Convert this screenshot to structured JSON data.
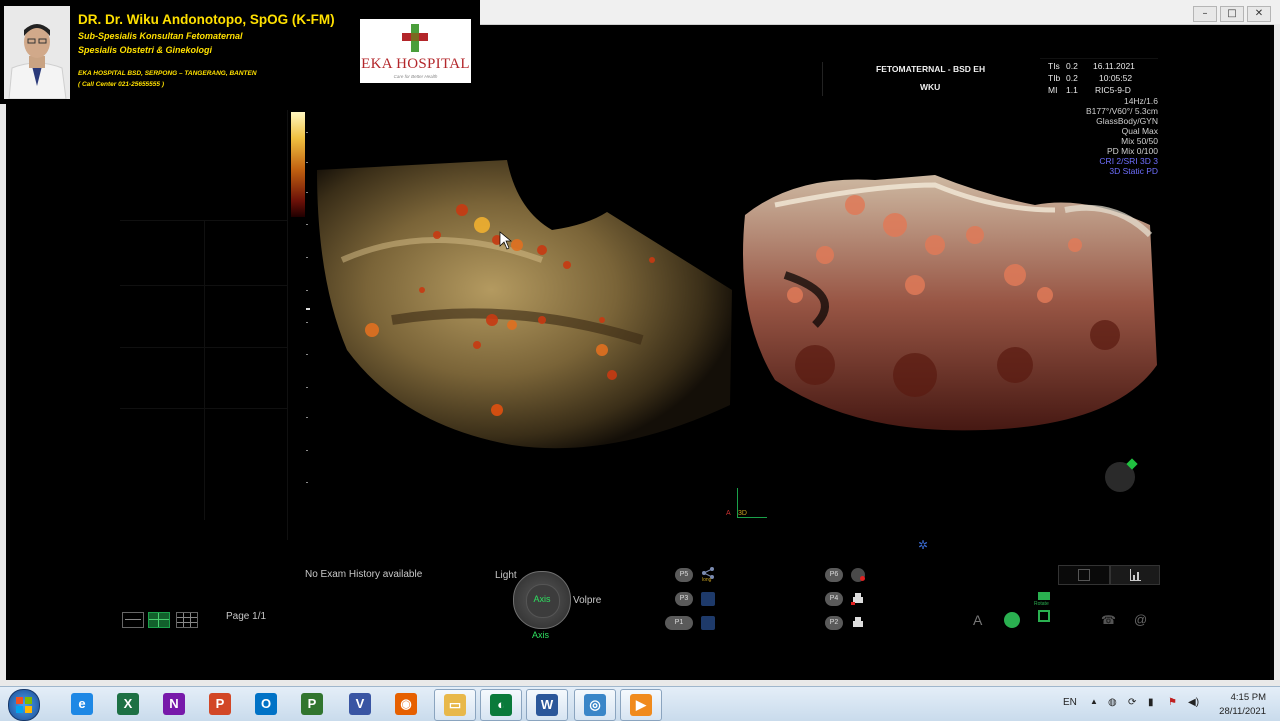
{
  "banner": {
    "doctor_name": "DR. Dr. Wiku Andonotopo, SpOG (K-FM)",
    "subtitle1": "Sub-Spesialis Konsultan Fetomaternal",
    "subtitle2": "Spesialis Obstetri & Ginekologi",
    "address": "EKA HOSPITAL BSD, SERPONG – TANGERANG, BANTEN",
    "call_center": "( Call Center 021-25655555 )",
    "logo_text": "EKA HOSPITAL",
    "logo_tagline": "Care for Better Health"
  },
  "window": {
    "minimize_label": "–",
    "maximize_label": "□",
    "close_label": "✕"
  },
  "info": {
    "institution": "FETOMATERNAL - BSD EH",
    "operator": "WKU",
    "tis_label": "TIs",
    "tis_value": "0.2",
    "tib_label": "TIb",
    "tib_value": "0.2",
    "mi_label": "MI",
    "mi_value": "1.1",
    "date": "16.11.2021",
    "time": "10:05:52",
    "probe": "RIC5-9-D"
  },
  "params": [
    {
      "text": "14Hz/1.6",
      "color": "#d0d0d0"
    },
    {
      "text": "B177°/V60°/ 5.3cm",
      "color": "#d0d0d0"
    },
    {
      "text": "GlassBody/GYN",
      "color": "#d0d0d0"
    },
    {
      "text": "Qual Max",
      "color": "#d0d0d0"
    },
    {
      "text": "Mix 50/50",
      "color": "#d0d0d0"
    },
    {
      "text": "PD Mix 0/100",
      "color": "#d0d0d0"
    },
    {
      "text": "CRI 2/SRI 3D 3",
      "color": "#6f6fff"
    },
    {
      "text": "3D Static PD",
      "color": "#6f6fff"
    }
  ],
  "view_marker": {
    "a": "A",
    "three_d": "3D"
  },
  "history": {
    "text": "No Exam History available"
  },
  "page": {
    "label": "Page 1/1"
  },
  "dial": {
    "light": "Light",
    "center": "Axis",
    "volpre": "Volpre",
    "axis": "Axis"
  },
  "presets_left": [
    "P5",
    "P3",
    "P1"
  ],
  "presets_right": [
    "P6",
    "P4",
    "P2"
  ],
  "preset_tags": {
    "p5_tag": "long"
  },
  "bottom_right": {
    "a_label": "A",
    "rotate_label": "Rotate",
    "at_label": "@"
  },
  "taskbar": {
    "start": "start-orb",
    "apps": [
      {
        "name": "internet-explorer",
        "glyph": "e",
        "color": "#1e88e5"
      },
      {
        "name": "excel",
        "glyph": "X",
        "color": "#1d7044"
      },
      {
        "name": "onenote",
        "glyph": "N",
        "color": "#7719aa"
      },
      {
        "name": "powerpoint",
        "glyph": "P",
        "color": "#d24726"
      },
      {
        "name": "outlook",
        "glyph": "O",
        "color": "#0072c6"
      },
      {
        "name": "project",
        "glyph": "P",
        "color": "#31752f"
      },
      {
        "name": "visio",
        "glyph": "V",
        "color": "#3955a3"
      },
      {
        "name": "firefox",
        "glyph": "◉",
        "color": "#e66000"
      },
      {
        "name": "file-explorer",
        "glyph": "▭",
        "color": "#e8b84a"
      },
      {
        "name": "viewpoint",
        "glyph": "◐",
        "color": "#0a7a3a"
      },
      {
        "name": "word",
        "glyph": "W",
        "color": "#2b579a"
      },
      {
        "name": "remote-desktop",
        "glyph": "◎",
        "color": "#3a86c8"
      },
      {
        "name": "media-player",
        "glyph": "▶",
        "color": "#f08a1c"
      }
    ],
    "language": "EN",
    "time": "4:15 PM",
    "date": "28/11/2021"
  },
  "colors": {
    "banner_text": "#ffe000",
    "logo_red": "#b3262a",
    "logo_cross_green": "#4a9e3b",
    "param_blue": "#6f6fff",
    "doppler_orange": "#e07020"
  }
}
